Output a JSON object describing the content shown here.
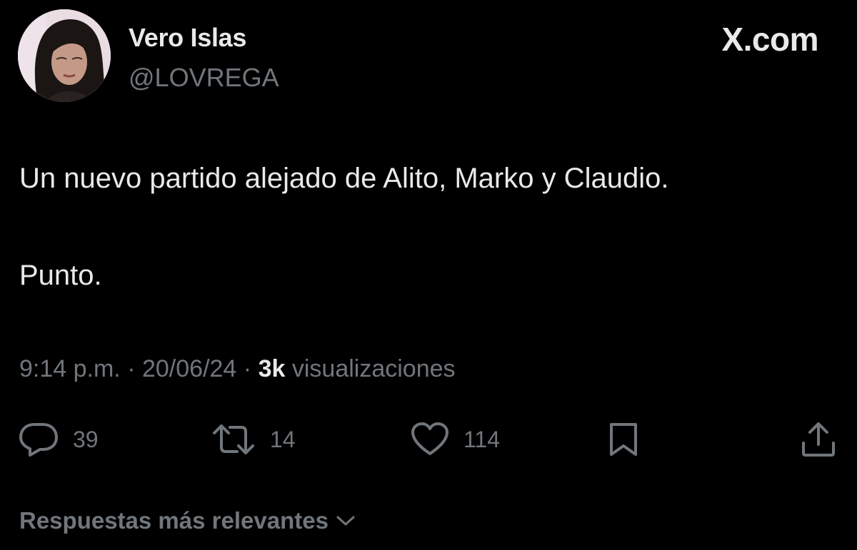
{
  "author": {
    "display_name": "Vero Islas",
    "handle": "@LOVREGA",
    "avatar_icon": "profile-photo"
  },
  "brand": {
    "label": "X.com"
  },
  "tweet": {
    "lines": [
      "Un nuevo partido alejado de Alito, Marko y Claudio.",
      "Punto."
    ]
  },
  "meta": {
    "time": "9:14 p.m.",
    "separator": "·",
    "date": "20/06/24",
    "views_count": "3k",
    "views_label": "visualizaciones"
  },
  "actions": {
    "replies": "39",
    "reposts": "14",
    "likes": "114",
    "reply_icon": "reply-icon",
    "repost_icon": "repost-icon",
    "like_icon": "heart-icon",
    "bookmark_icon": "bookmark-icon",
    "share_icon": "share-icon"
  },
  "replies_sort": {
    "label": "Respuestas más relevantes"
  },
  "colors": {
    "background": "#000000",
    "primary_text": "#e7e9ea",
    "secondary_text": "#71767b"
  }
}
